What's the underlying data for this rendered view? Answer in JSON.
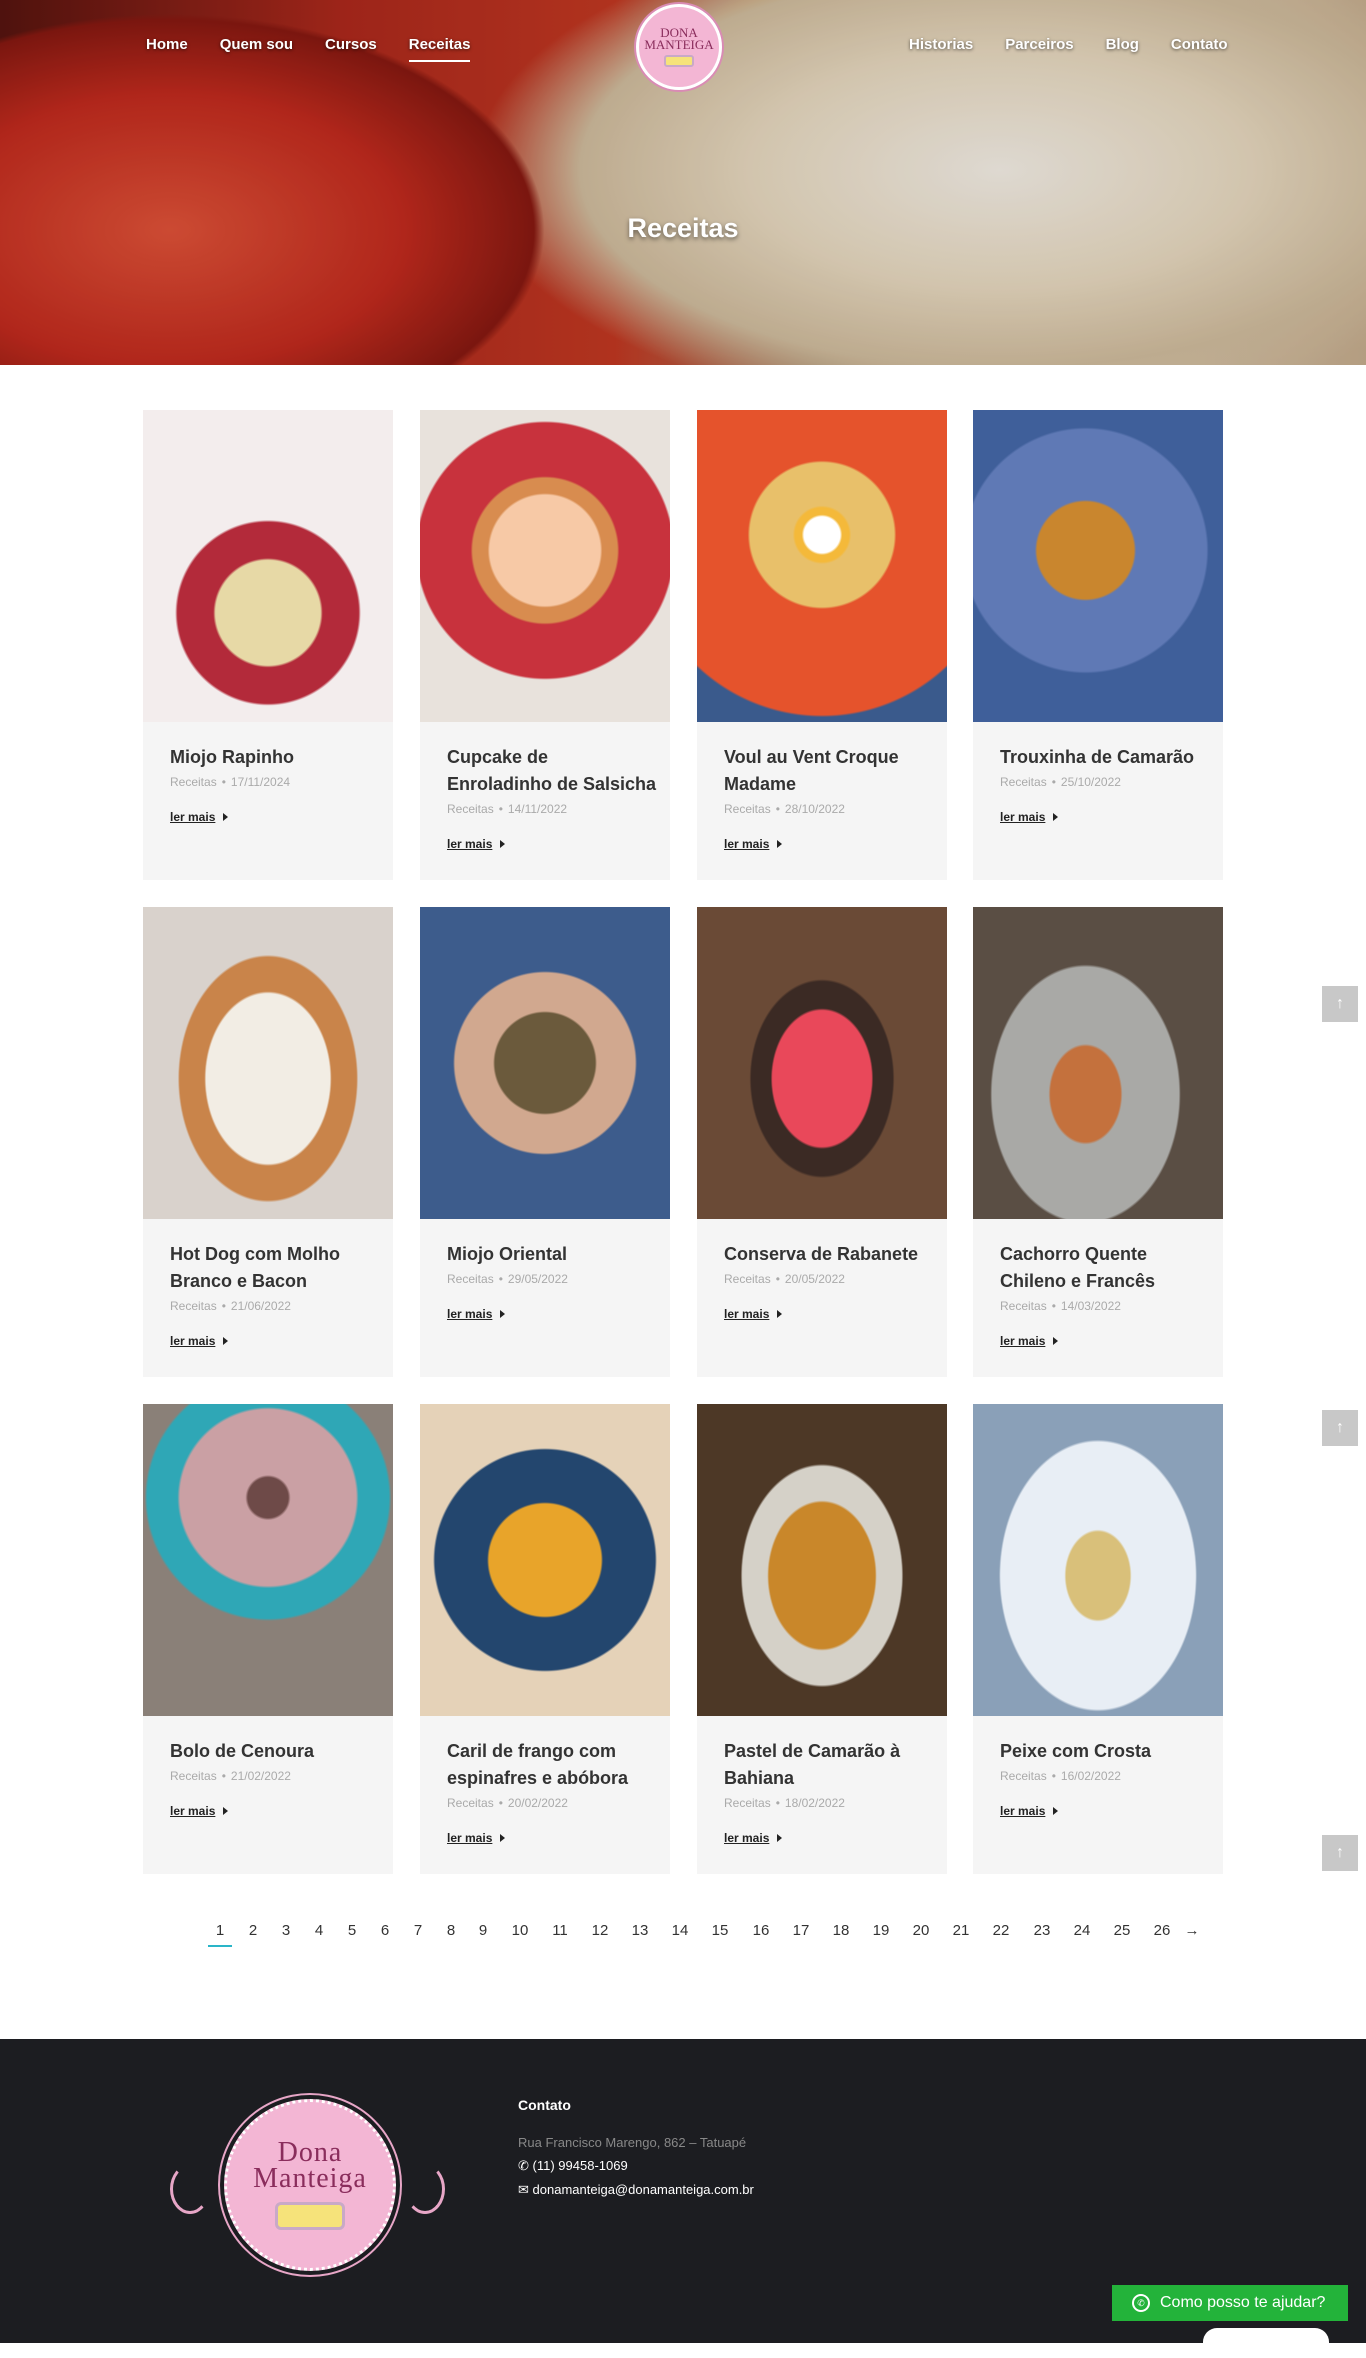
{
  "nav": {
    "left": [
      "Home",
      "Quem sou",
      "Cursos",
      "Receitas"
    ],
    "right": [
      "Historias",
      "Parceiros",
      "Blog",
      "Contato"
    ],
    "active": "Receitas"
  },
  "logo": {
    "line1": "DONA",
    "line2": "MANTEIGA"
  },
  "hero": {
    "title": "Receitas"
  },
  "recipes": [
    {
      "title": "Miojo Rapinho",
      "category": "Receitas",
      "date": "17/11/2024",
      "more": "ler mais"
    },
    {
      "title": "Cupcake de Enroladinho de Salsicha",
      "category": "Receitas",
      "date": "14/11/2022",
      "more": "ler mais"
    },
    {
      "title": "Voul au Vent Croque Madame",
      "category": "Receitas",
      "date": "28/10/2022",
      "more": "ler mais"
    },
    {
      "title": "Trouxinha de Camarão",
      "category": "Receitas",
      "date": "25/10/2022",
      "more": "ler mais"
    },
    {
      "title": "Hot Dog com Molho Branco e Bacon",
      "category": "Receitas",
      "date": "21/06/2022",
      "more": "ler mais"
    },
    {
      "title": "Miojo Oriental",
      "category": "Receitas",
      "date": "29/05/2022",
      "more": "ler mais"
    },
    {
      "title": "Conserva de Rabanete",
      "category": "Receitas",
      "date": "20/05/2022",
      "more": "ler mais"
    },
    {
      "title": "Cachorro Quente Chileno e Francês",
      "category": "Receitas",
      "date": "14/03/2022",
      "more": "ler mais"
    },
    {
      "title": "Bolo de Cenoura",
      "category": "Receitas",
      "date": "21/02/2022",
      "more": "ler mais"
    },
    {
      "title": "Caril de frango com espinafres e abóbora",
      "category": "Receitas",
      "date": "20/02/2022",
      "more": "ler mais"
    },
    {
      "title": "Pastel de Camarão à Bahiana",
      "category": "Receitas",
      "date": "18/02/2022",
      "more": "ler mais"
    },
    {
      "title": "Peixe com Crosta",
      "category": "Receitas",
      "date": "16/02/2022",
      "more": "ler mais"
    }
  ],
  "pagination": {
    "pages": [
      "1",
      "2",
      "3",
      "4",
      "5",
      "6",
      "7",
      "8",
      "9",
      "10",
      "11",
      "12",
      "13",
      "14",
      "15",
      "16",
      "17",
      "18",
      "19",
      "20",
      "21",
      "22",
      "23",
      "24",
      "25",
      "26"
    ],
    "current": "1",
    "next": "→"
  },
  "footer": {
    "logo_line1": "Dona",
    "logo_line2": "Manteiga",
    "heading": "Contato",
    "address": "Rua Francisco Marengo, 862 – Tatuapé",
    "phone": "(11) 99458-1069",
    "email": "donamanteiga@donamanteiga.com.br"
  },
  "whatsapp": {
    "label": "Como posso te ajudar?"
  },
  "colors": {
    "accent": "#2ab5c8",
    "footer_bg": "#1c1d21",
    "whatsapp": "#23b33a"
  }
}
